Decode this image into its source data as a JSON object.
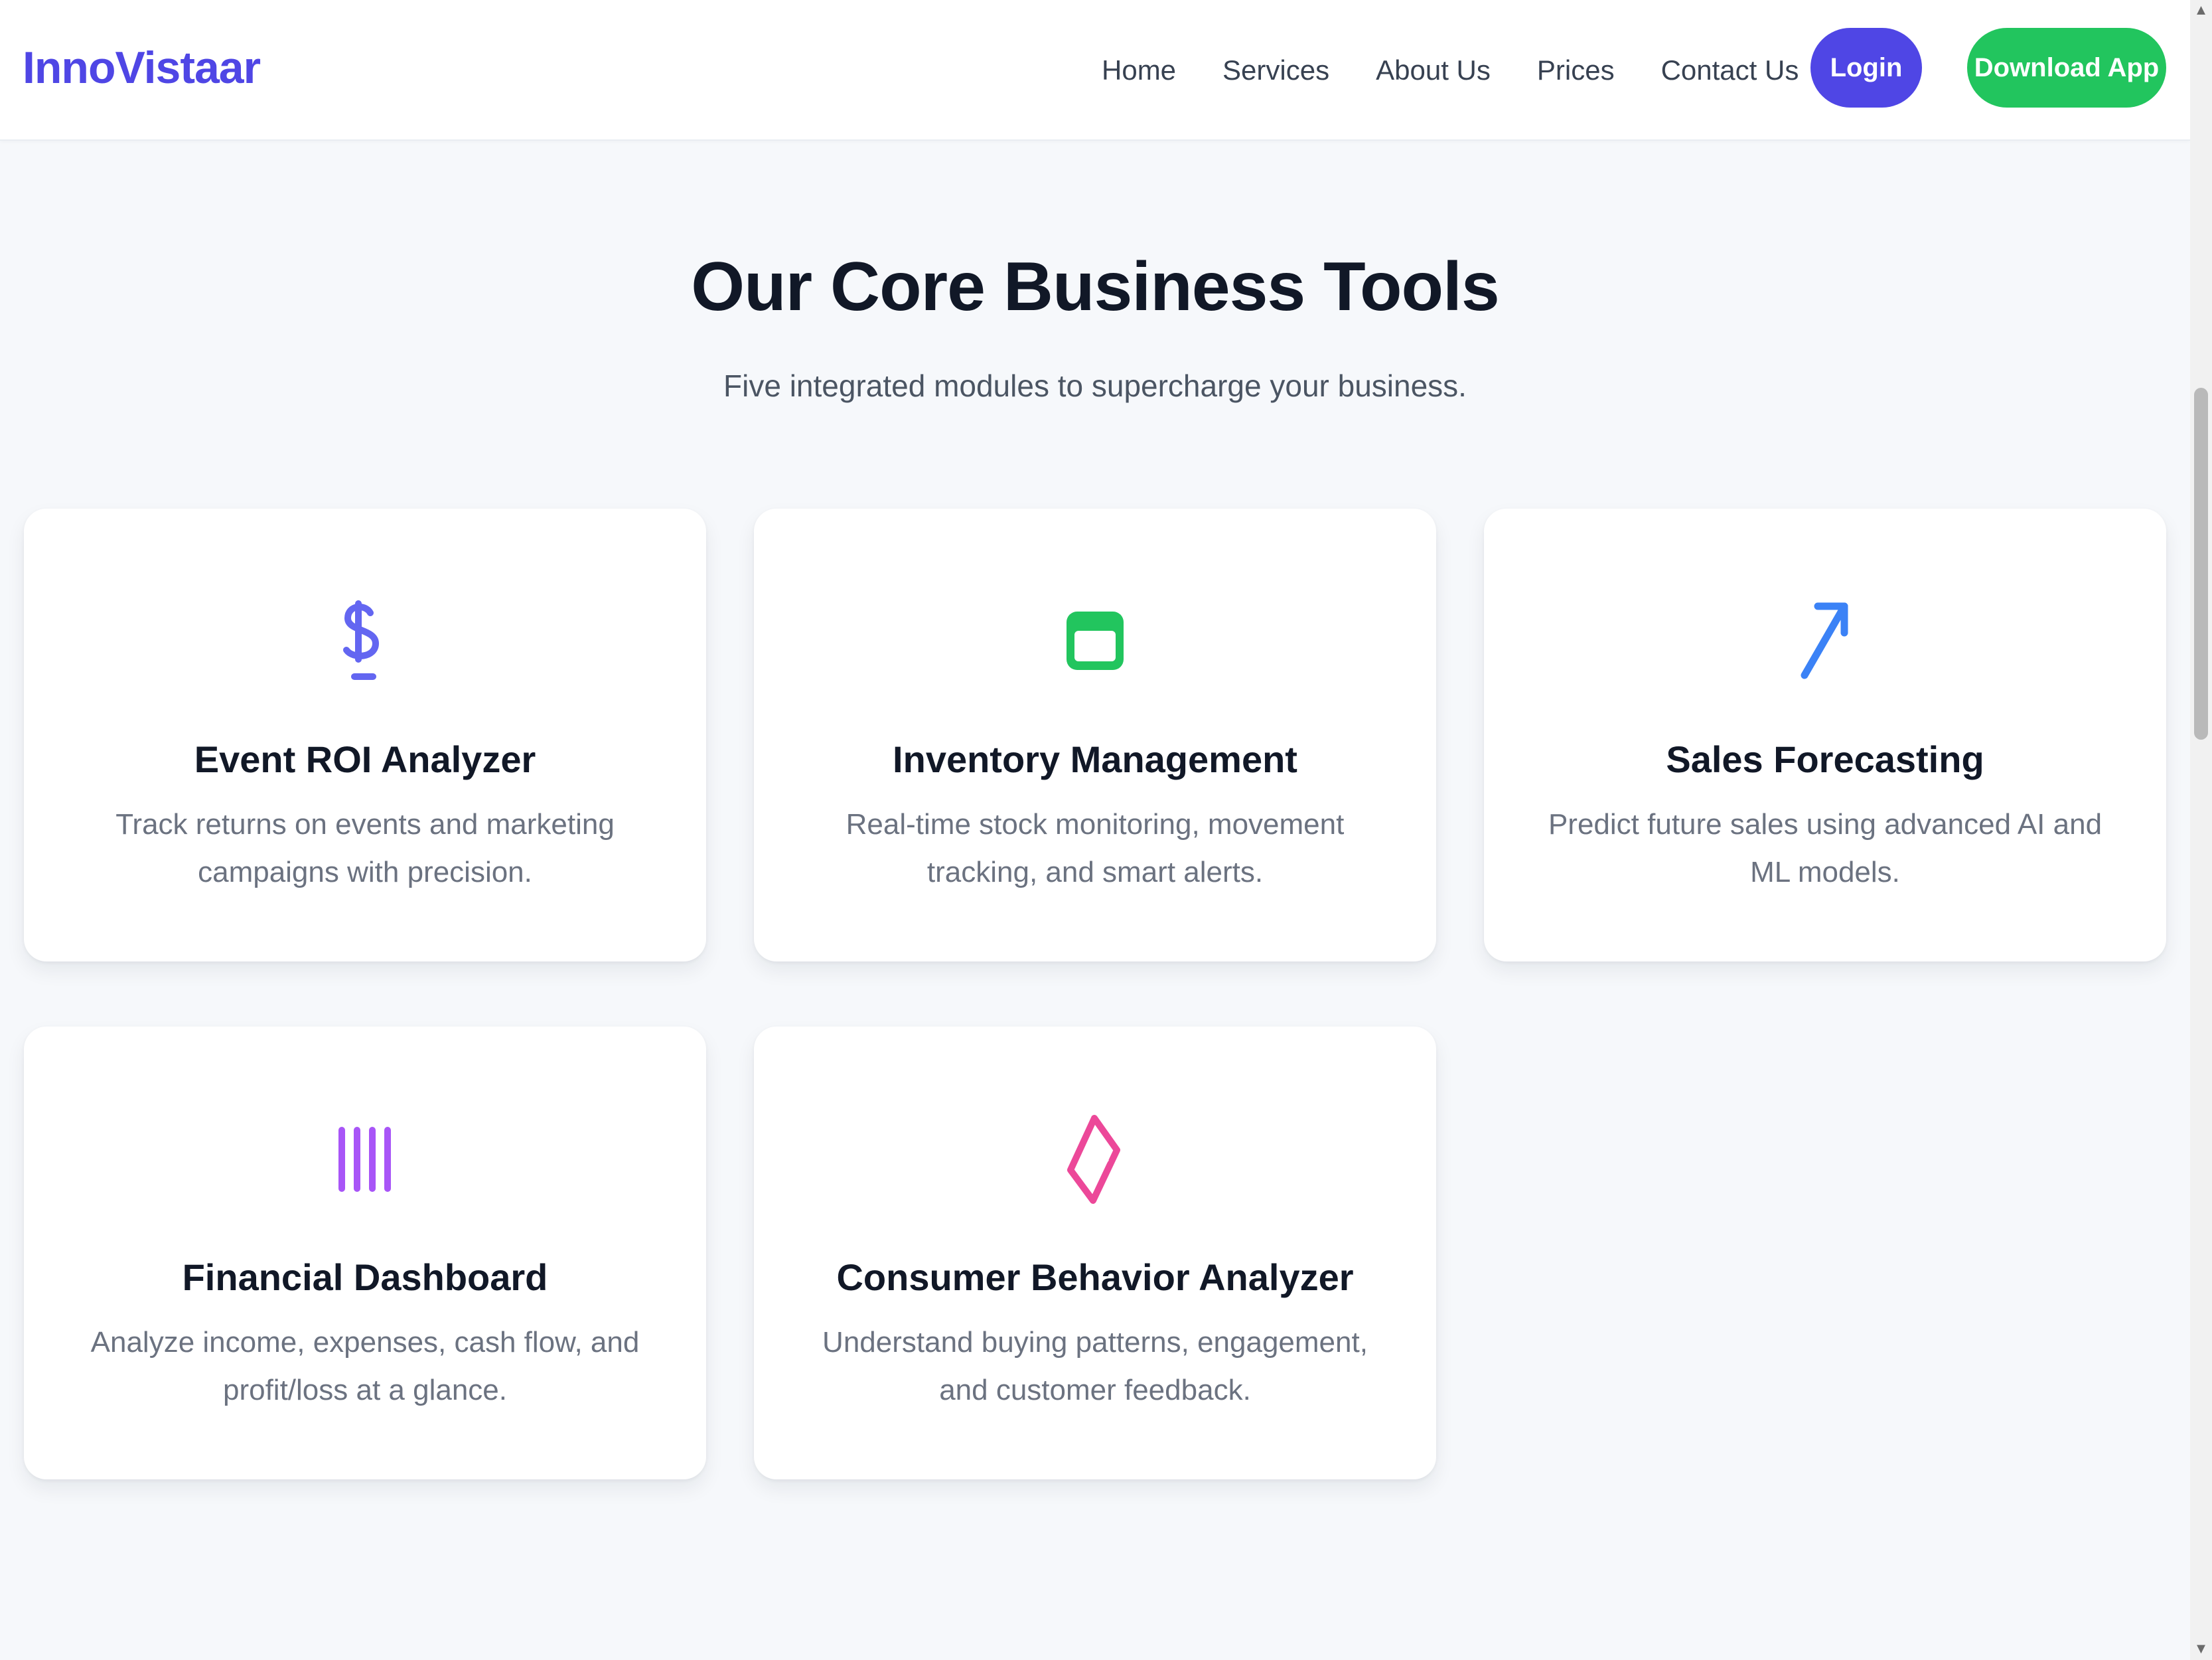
{
  "header": {
    "brand": "InnoVistaar",
    "nav": [
      "Home",
      "Services",
      "About Us",
      "Prices",
      "Contact Us"
    ],
    "login_label": "Login",
    "download_label": "Download App",
    "colors": {
      "brand": "#4f46e5",
      "login_bg": "#4f46e5",
      "download_bg": "#22c55e"
    }
  },
  "section": {
    "title": "Our Core Business Tools",
    "subtitle": "Five integrated modules to supercharge your business."
  },
  "cards": [
    {
      "icon": "dollar-sign-icon",
      "icon_color": "#6366f1",
      "title": "Event ROI Analyzer",
      "description": "Track returns on events and marketing campaigns with precision."
    },
    {
      "icon": "window-box-icon",
      "icon_color": "#22c55e",
      "title": "Inventory Management",
      "description": "Real-time stock monitoring, movement tracking, and smart alerts."
    },
    {
      "icon": "arrow-up-right-icon",
      "icon_color": "#3b82f6",
      "title": "Sales Forecasting",
      "description": "Predict future sales using advanced AI and ML models."
    },
    {
      "icon": "vertical-bars-icon",
      "icon_color": "#a855f7",
      "title": "Financial Dashboard",
      "description": "Analyze income, expenses, cash flow, and profit/loss at a glance."
    },
    {
      "icon": "diamond-chevron-icon",
      "icon_color": "#ec4899",
      "title": "Consumer Behavior Analyzer",
      "description": "Understand buying patterns, engagement, and customer feedback."
    }
  ]
}
